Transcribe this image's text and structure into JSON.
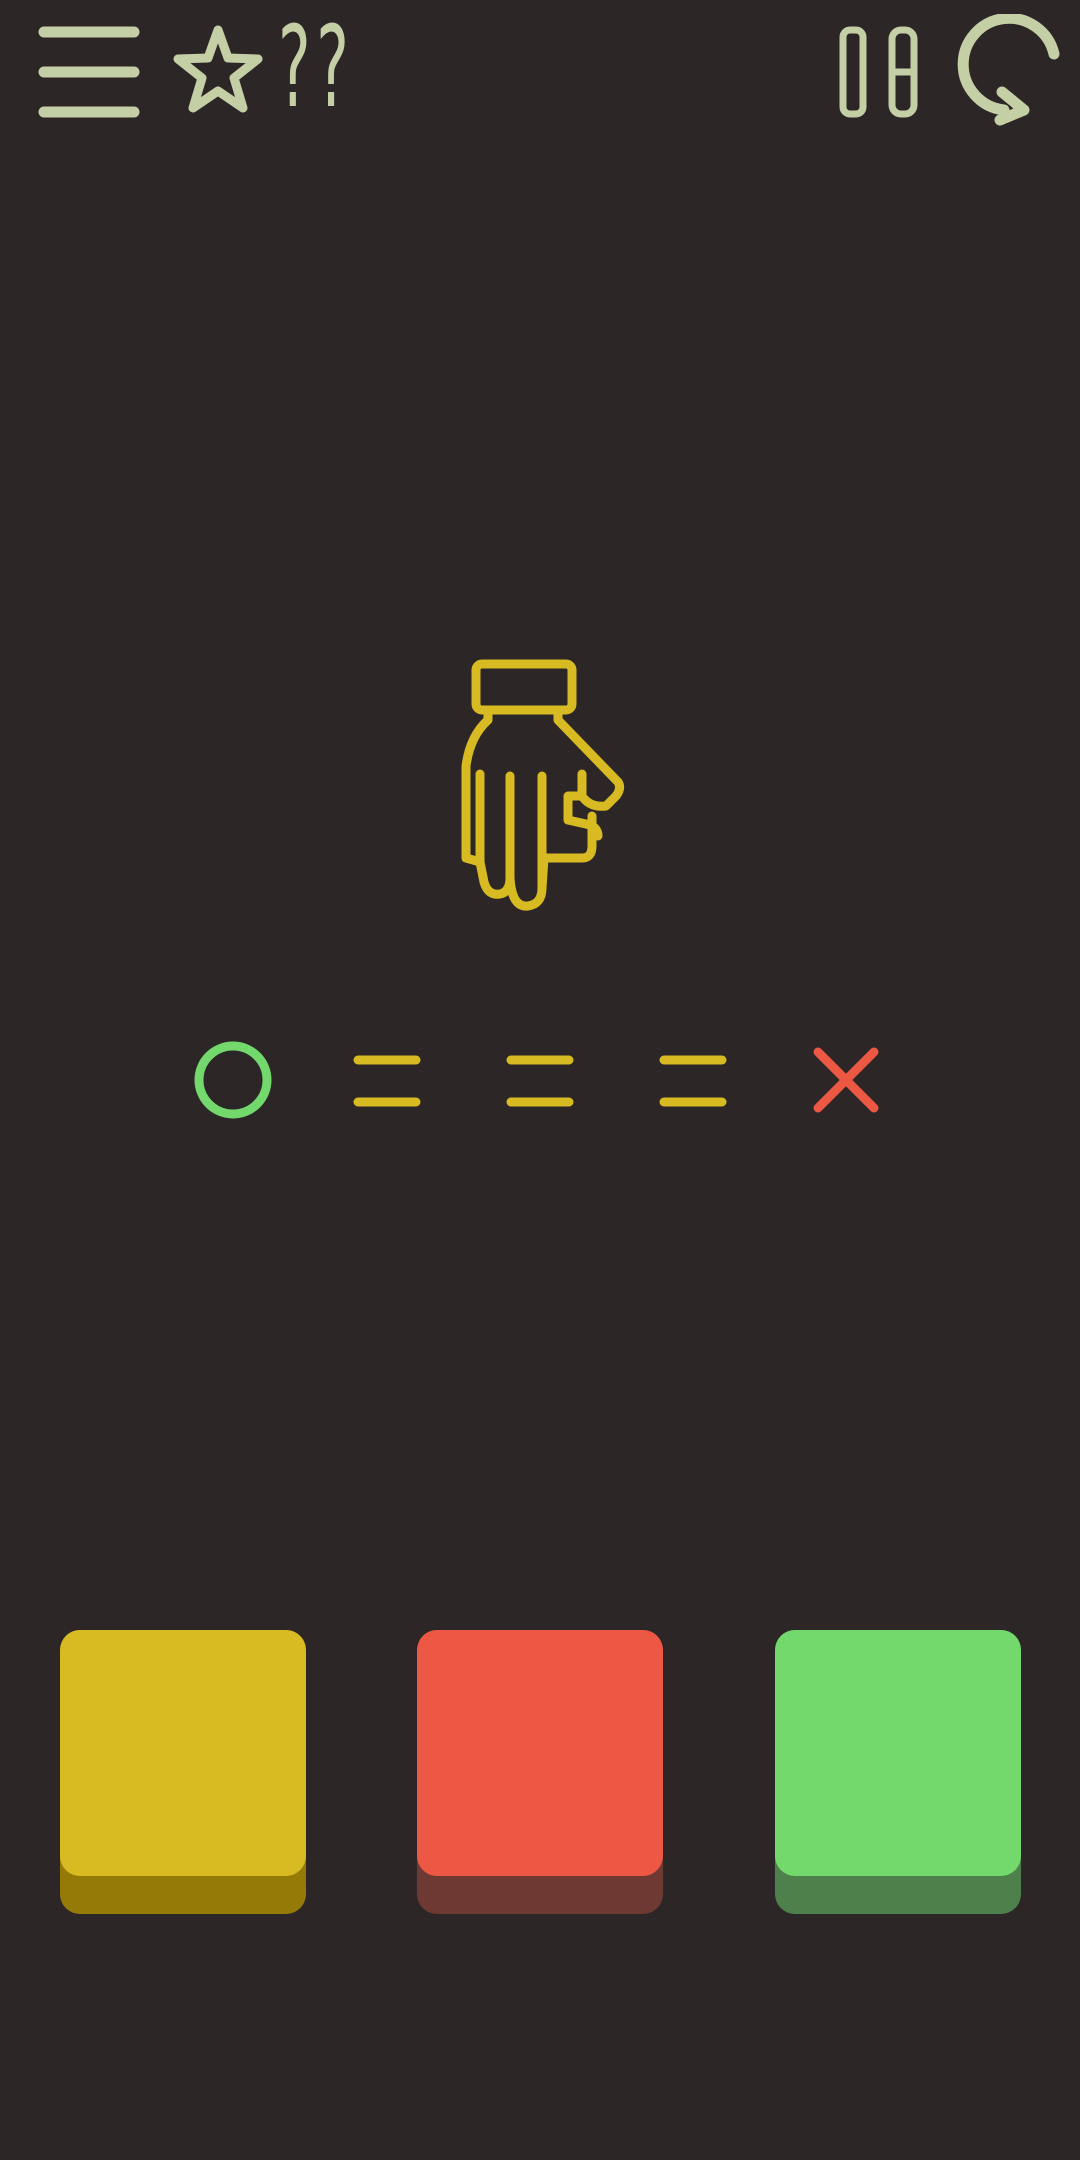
{
  "header": {
    "stars_value": "??",
    "icons": {
      "menu": "hamburger-menu-icon",
      "star": "star-icon",
      "level": "level-number-icon",
      "restart": "restart-icon"
    }
  },
  "prompt": {
    "icon": "hand-pointing-down-icon",
    "color": "#d8ba22"
  },
  "sequence": [
    {
      "symbol": "circle",
      "color": "#73d96c"
    },
    {
      "symbol": "equals",
      "color": "#d8ba22"
    },
    {
      "symbol": "equals",
      "color": "#d8ba22"
    },
    {
      "symbol": "equals",
      "color": "#d8ba22"
    },
    {
      "symbol": "cross",
      "color": "#ec5843"
    }
  ],
  "buttons": [
    {
      "name": "yellow",
      "face": "#d8ba22",
      "shadow": "#947b08"
    },
    {
      "name": "red",
      "face": "#ec5843",
      "shadow": "#6e3833"
    },
    {
      "name": "green",
      "face": "#73d96c",
      "shadow": "#4e804b"
    }
  ],
  "colors": {
    "background": "#2c2626",
    "ui": "#c4cfa5"
  }
}
